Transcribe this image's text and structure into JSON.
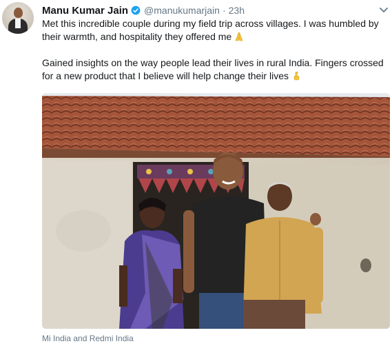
{
  "tweet": {
    "author": {
      "name": "Manu Kumar Jain",
      "handle": "@manukumarjain",
      "verified": true
    },
    "separator": "·",
    "timestamp": "23h",
    "text_lines": [
      "Met this incredible couple during my field trip across villages. I was humbled by",
      "their warmth, and hospitality they offered me",
      "",
      "Gained insights on the way people lead their lives in rural India. Fingers crossed",
      "for a new product that I believe will help change their lives"
    ],
    "emojis": [
      "folded-hands-icon",
      "crossed-fingers-icon"
    ],
    "tagged": "Mi India and Redmi India",
    "colors": {
      "verified_blue": "#1da1f2",
      "secondary_text": "#657786",
      "primary_text": "#14171a"
    }
  }
}
